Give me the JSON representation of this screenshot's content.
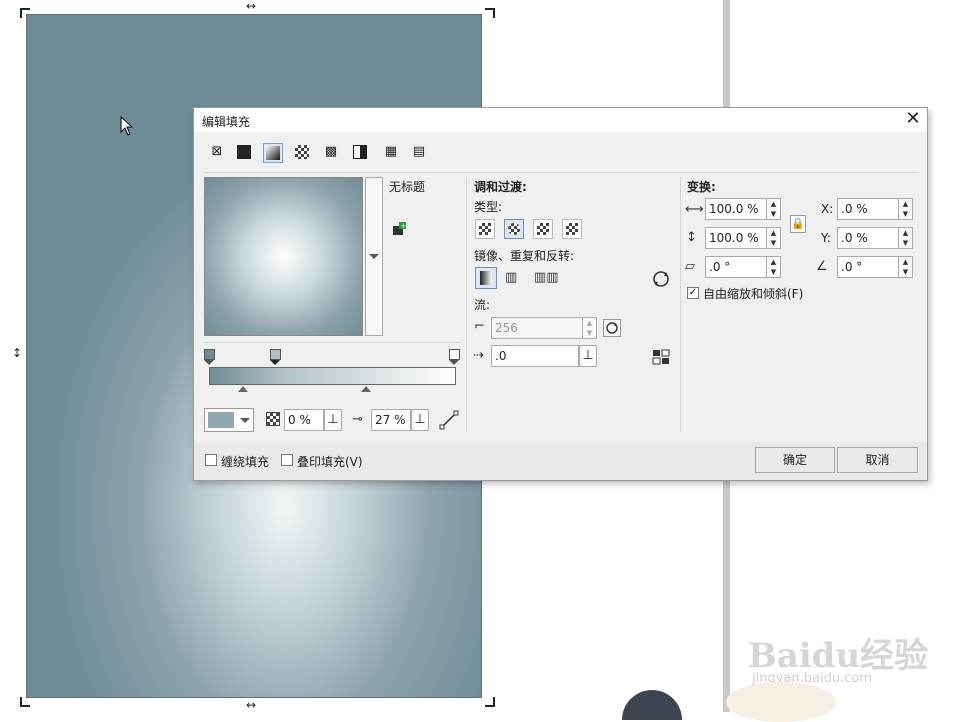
{
  "dialog": {
    "title": "编辑填充",
    "close_icon": "close-icon",
    "fill_types": [
      "no-fill-icon",
      "uniform-fill-icon",
      "fountain-fill-icon",
      "vector-pattern-icon",
      "bitmap-pattern-icon",
      "two-color-pattern-icon",
      "texture-fill-icon",
      "postscript-fill-icon"
    ],
    "preview_name": "无标题",
    "blend": {
      "heading": "调和过渡:",
      "type_label": "类型:",
      "mirror_label": "镜像、重复和反转:",
      "flow_label": "流:",
      "steps_value": "256",
      "accel_value": ".0"
    },
    "transform": {
      "heading": "变换:",
      "width_value": "100.0 %",
      "height_value": "100.0 %",
      "skew_value": ".0 °",
      "x_label": "X:",
      "x_value": ".0 %",
      "y_label": "Y:",
      "y_value": ".0 %",
      "rotate_value": ".0 °",
      "free_scale_label": "自由缩放和倾斜(F)",
      "free_scale_checked": true
    },
    "bottom": {
      "transparency_value": "0 %",
      "position_value": "27 %",
      "node_color": "#8fa7af"
    },
    "footer": {
      "wrap_fill_label": "缠绕填充",
      "overprint_label": "叠印填充(V)",
      "ok_label": "确定",
      "cancel_label": "取消"
    }
  },
  "gradient": {
    "start_color": "#6f8c96",
    "end_color": "#ffffff"
  },
  "watermark": {
    "logo_text": "Baidu经验",
    "sub_text": "jingyan.baidu.com"
  }
}
